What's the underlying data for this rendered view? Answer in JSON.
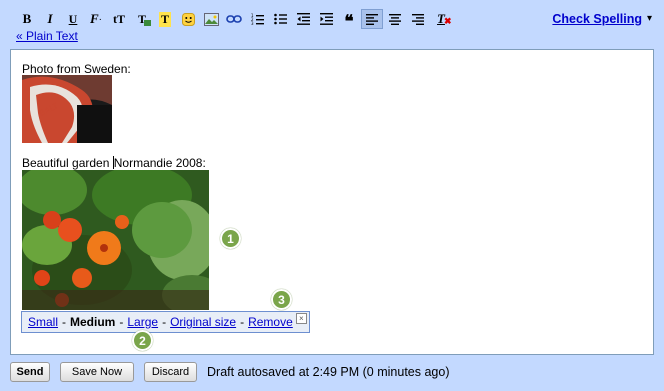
{
  "toolbar": {
    "buttons": [
      {
        "label": "B",
        "icon": "bold-icon"
      },
      {
        "label": "I",
        "icon": "italic-icon"
      },
      {
        "label": "U",
        "icon": "underline-icon"
      },
      {
        "label": "F",
        "icon": "font-icon"
      },
      {
        "label": "tT",
        "icon": "font-size-icon"
      },
      {
        "label": "T",
        "icon": "text-color-icon"
      },
      {
        "label": "T",
        "icon": "highlight-color-icon"
      },
      {
        "label": "",
        "icon": "emoticon-icon"
      },
      {
        "label": "",
        "icon": "insert-image-icon"
      },
      {
        "label": "",
        "icon": "link-icon"
      },
      {
        "label": "",
        "icon": "numbered-list-icon"
      },
      {
        "label": "",
        "icon": "bulleted-list-icon"
      },
      {
        "label": "",
        "icon": "indent-less-icon"
      },
      {
        "label": "",
        "icon": "indent-more-icon"
      },
      {
        "label": "",
        "icon": "quote-icon"
      },
      {
        "label": "",
        "icon": "align-left-icon"
      },
      {
        "label": "",
        "icon": "align-center-icon"
      },
      {
        "label": "",
        "icon": "align-right-icon"
      },
      {
        "label": "T",
        "icon": "remove-formatting-icon"
      }
    ],
    "check_spelling": "Check Spelling",
    "check_arrow": "▾",
    "plain_text": "« Plain Text"
  },
  "editor": {
    "line1": "Photo from Sweden:",
    "line2_before": "Beautiful garden ",
    "line2_after": "Normandie 2008:"
  },
  "resize": {
    "small": "Small",
    "medium": "Medium",
    "large": "Large",
    "original": "Original size",
    "remove": "Remove",
    "separator": "-",
    "close": "×"
  },
  "badges": [
    "1",
    "2",
    "3"
  ],
  "footer": {
    "send": "Send",
    "save_now": "Save Now",
    "discard": "Discard",
    "draft_status": "Draft autosaved at 2:49 PM (0 minutes ago)"
  },
  "colors": {
    "frame_bg": "#c3d9ff",
    "link": "#0000cc",
    "badge": "#7aa54a",
    "resize_bg": "#e8eef7"
  }
}
